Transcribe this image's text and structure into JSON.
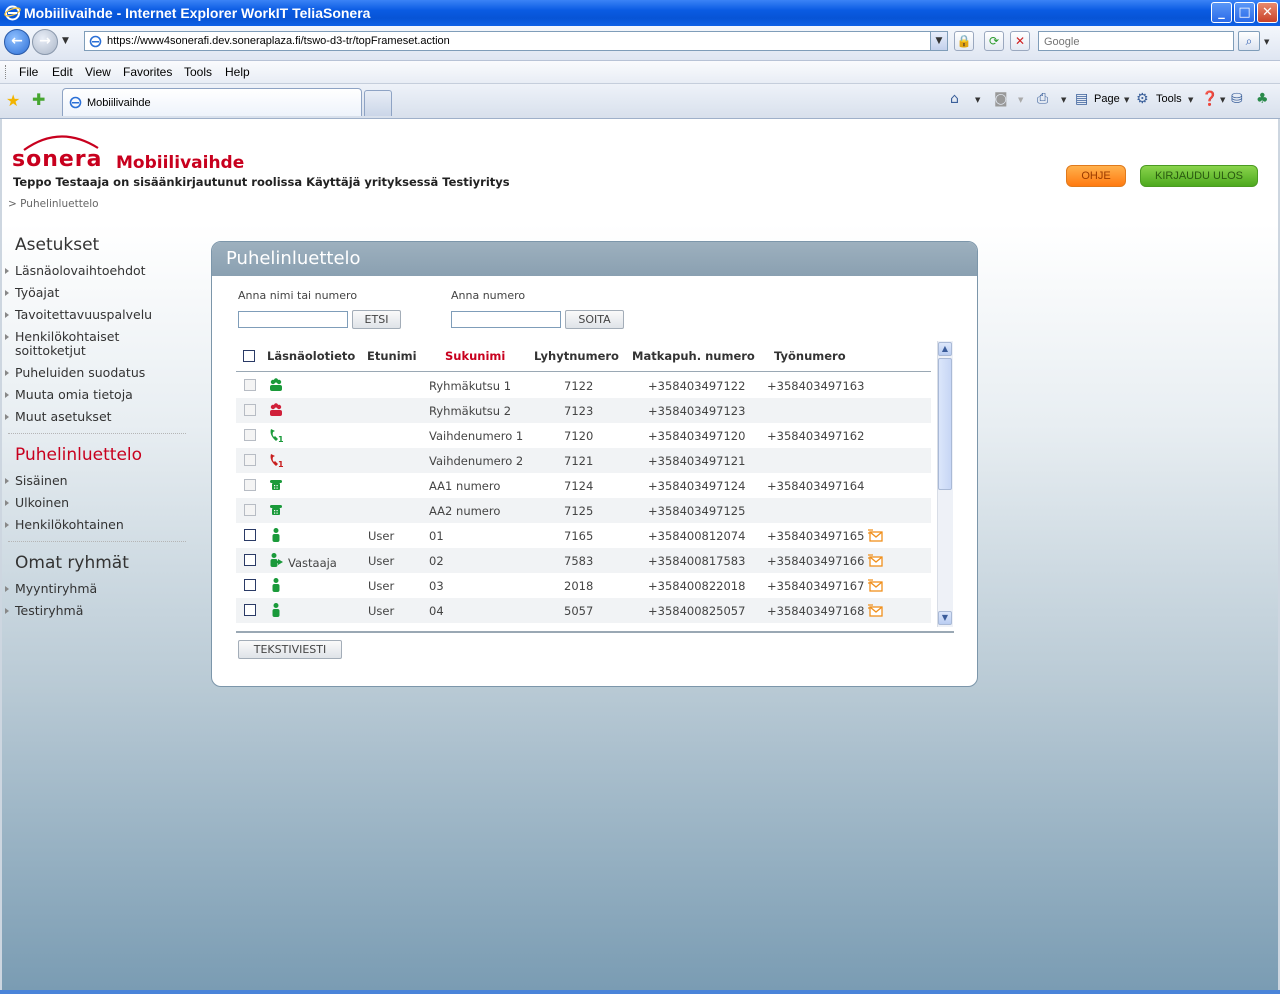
{
  "window": {
    "title": "Mobiilivaihde - Internet Explorer WorkIT TeliaSonera",
    "minimize": "_",
    "maximize": "□",
    "close": "✕"
  },
  "browser": {
    "url": "https://www4sonerafi.dev.soneraplaza.fi/tswo-d3-tr/topFrameset.action",
    "search_placeholder": "Google",
    "menu": [
      "File",
      "Edit",
      "View",
      "Favorites",
      "Tools",
      "Help"
    ],
    "tab_label": "Mobiilivaihde",
    "commands": {
      "page": "Page",
      "tools": "Tools"
    },
    "accent": "#0a5be2"
  },
  "header": {
    "logo_text": "sonera",
    "app_title": "Mobiilivaihde",
    "user_line": "Teppo Testaaja on sisäänkirjautunut roolissa Käyttäjä yrityksessä Testiyritys",
    "breadcrumb": "> Puhelinluettelo",
    "help_button": "OHJE",
    "logout_button": "KIRJAUDU ULOS",
    "brand_color": "#c8001e"
  },
  "sidebar": {
    "settings": {
      "title": "Asetukset",
      "items": [
        "Läsnäolovaihtoehdot",
        "Työajat",
        "Tavoitettavuuspalvelu",
        "Henkilökohtaiset soittoketjut",
        "Puheluiden suodatus",
        "Muuta omia tietoja",
        "Muut asetukset"
      ]
    },
    "directory": {
      "title": "Puhelinluettelo",
      "items": [
        "Sisäinen",
        "Ulkoinen",
        "Henkilökohtainen"
      ]
    },
    "groups": {
      "title": "Omat ryhmät",
      "items": [
        "Myyntiryhmä",
        "Testiryhmä"
      ]
    }
  },
  "panel": {
    "title": "Puhelinluettelo",
    "search_label": "Anna nimi tai numero",
    "search_button": "ETSI",
    "call_label": "Anna numero",
    "call_button": "SOITA",
    "sms_button": "TEKSTIVIESTI",
    "columns": [
      "Läsnäolotieto",
      "Etunimi",
      "Sukunimi",
      "Lyhytnumero",
      "Matkapuh. numero",
      "Työnumero"
    ],
    "rows": [
      {
        "icon": "group-green-icon",
        "status": "",
        "first": "",
        "last": "Ryhmäkutsu 1",
        "short": "7122",
        "mobile": "+358403497122",
        "work": "+358403497163",
        "mail": false,
        "enabled": false
      },
      {
        "icon": "group-red-icon",
        "status": "",
        "first": "",
        "last": "Ryhmäkutsu 2",
        "short": "7123",
        "mobile": "+358403497123",
        "work": "",
        "mail": false,
        "enabled": false
      },
      {
        "icon": "switchboard-green-icon",
        "status": "",
        "first": "",
        "last": "Vaihdenumero 1",
        "short": "7120",
        "mobile": "+358403497120",
        "work": "+358403497162",
        "mail": false,
        "enabled": false
      },
      {
        "icon": "switchboard-red-icon",
        "status": "",
        "first": "",
        "last": "Vaihdenumero 2",
        "short": "7121",
        "mobile": "+358403497121",
        "work": "",
        "mail": false,
        "enabled": false
      },
      {
        "icon": "telephone-icon",
        "status": "",
        "first": "",
        "last": "AA1 numero",
        "short": "7124",
        "mobile": "+358403497124",
        "work": "+358403497164",
        "mail": false,
        "enabled": false
      },
      {
        "icon": "telephone-icon",
        "status": "",
        "first": "",
        "last": "AA2 numero",
        "short": "7125",
        "mobile": "+358403497125",
        "work": "",
        "mail": false,
        "enabled": false
      },
      {
        "icon": "person-available-icon",
        "status": "",
        "first": "User",
        "last": "01",
        "short": "7165",
        "mobile": "+358400812074",
        "work": "+358403497165",
        "mail": true,
        "enabled": true
      },
      {
        "icon": "person-answering-icon",
        "status": "Vastaaja",
        "first": "User",
        "last": "02",
        "short": "7583",
        "mobile": "+358400817583",
        "work": "+358403497166",
        "mail": true,
        "enabled": true
      },
      {
        "icon": "person-available-icon",
        "status": "",
        "first": "User",
        "last": "03",
        "short": "2018",
        "mobile": "+358400822018",
        "work": "+358403497167",
        "mail": true,
        "enabled": true
      },
      {
        "icon": "person-available-icon",
        "status": "",
        "first": "User",
        "last": "04",
        "short": "5057",
        "mobile": "+358400825057",
        "work": "+358403497168",
        "mail": true,
        "enabled": true
      }
    ]
  }
}
